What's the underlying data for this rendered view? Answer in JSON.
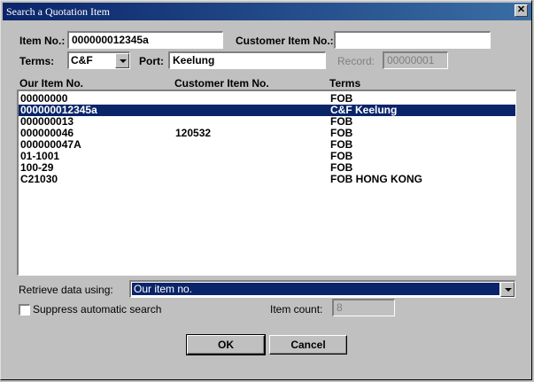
{
  "window": {
    "title": "Search a Quotation Item",
    "close_glyph": "✕"
  },
  "form": {
    "item_no_label": "Item No.:",
    "item_no_value": "000000012345a",
    "customer_item_no_label": "Customer Item No.:",
    "customer_item_no_value": "",
    "terms_label": "Terms:",
    "terms_value": "C&F",
    "port_label": "Port:",
    "port_value": "Keelung",
    "record_label": "Record:",
    "record_value": "00000001"
  },
  "table": {
    "headers": [
      "Our Item No.",
      "Customer Item No.",
      "Terms"
    ],
    "rows": [
      {
        "item": "00000000",
        "customer": "",
        "terms": "FOB",
        "selected": false
      },
      {
        "item": "000000012345a",
        "customer": "",
        "terms": "C&F Keelung",
        "selected": true
      },
      {
        "item": "000000013",
        "customer": "",
        "terms": "FOB",
        "selected": false
      },
      {
        "item": "000000046",
        "customer": "120532",
        "terms": "FOB",
        "selected": false
      },
      {
        "item": "000000047A",
        "customer": "",
        "terms": "FOB",
        "selected": false
      },
      {
        "item": "01-1001",
        "customer": "",
        "terms": "FOB",
        "selected": false
      },
      {
        "item": "100-29",
        "customer": "",
        "terms": "FOB",
        "selected": false
      },
      {
        "item": "C21030",
        "customer": "",
        "terms": "FOB HONG KONG",
        "selected": false
      }
    ]
  },
  "retrieve": {
    "label": "Retrieve data using:",
    "value": "Our item no."
  },
  "suppress": {
    "label": "Suppress automatic search",
    "checked": false
  },
  "item_count": {
    "label": "Item count:",
    "value": "8"
  },
  "buttons": {
    "ok": "OK",
    "cancel": "Cancel"
  }
}
